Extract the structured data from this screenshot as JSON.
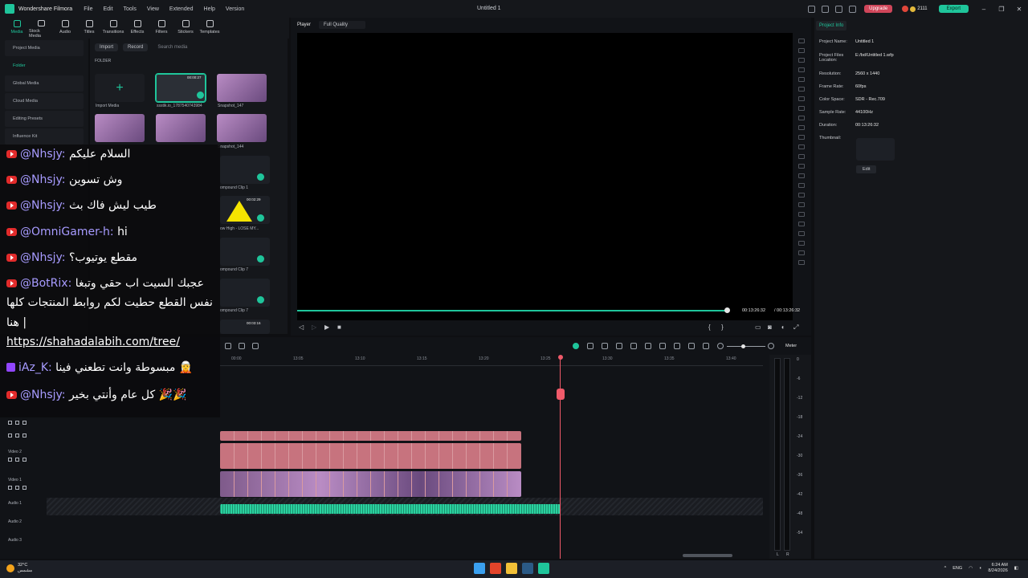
{
  "app": {
    "name": "Wondershare Filmora",
    "doc_title": "Untitled 1",
    "menus": [
      "File",
      "Edit",
      "Tools",
      "View",
      "Extended",
      "Help",
      "Version"
    ],
    "upgrade": "Upgrade",
    "credits": "2111",
    "export": "Export"
  },
  "tabs": [
    "Media",
    "Stock Media",
    "Audio",
    "Titles",
    "Transitions",
    "Effects",
    "Filters",
    "Stickers",
    "Templates"
  ],
  "sidebar": {
    "items": [
      "Project Media",
      "Folder",
      "Global Media",
      "Cloud Media",
      "Editing Presets",
      "Influence Kit"
    ]
  },
  "media": {
    "import": "Import",
    "record": "Record",
    "search_placeholder": "Search media",
    "folder_label": "FOLDER",
    "items": [
      {
        "label": "Import Media"
      },
      {
        "label": "ssstik.io_1787540743984",
        "duration": "00:00:27"
      },
      {
        "label": "Snapshot_147"
      },
      {
        "label": ""
      },
      {
        "label": ""
      },
      {
        "label": "Snapshot_144"
      },
      {
        "label": "ompound Clip 1"
      },
      {
        "label": "ow High - LOSE MY...",
        "duration": "00:02:29"
      },
      {
        "label": "ompound Clip 7"
      },
      {
        "label": "ompound Clip 7"
      },
      {
        "label": "",
        "duration": "00:03:16"
      }
    ]
  },
  "player": {
    "label": "Player",
    "quality": "Full Quality",
    "current": "00:13:26:32",
    "total": "/  00:13:26:32",
    "progress": 0.99
  },
  "project_info": {
    "tab": "Project Info",
    "rows": [
      {
        "k": "Project Name:",
        "v": "Untitled 1"
      },
      {
        "k": "Project Files Location:",
        "v": "E:/bd/Untitled 1.wfp"
      },
      {
        "k": "Resolution:",
        "v": "2560 x 1440"
      },
      {
        "k": "Frame Rate:",
        "v": "60fps"
      },
      {
        "k": "Color Space:",
        "v": "SDR - Rec.709"
      },
      {
        "k": "Sample Rate:",
        "v": "44100Hz"
      },
      {
        "k": "Duration:",
        "v": "00:13:26:32"
      },
      {
        "k": "Thumbnail:",
        "v": ""
      }
    ],
    "edit": "Edit"
  },
  "timeline": {
    "meter": "Meter",
    "ruler": [
      "00:00",
      "13:05",
      "13:10",
      "13:15",
      "13:20",
      "13:25",
      "13:30",
      "13:35",
      "13:40"
    ],
    "tracks": [
      "Video 2",
      "Video 1",
      "Audio 1",
      "Audio 2",
      "Audio 3"
    ],
    "db": [
      "0",
      "-6",
      "-12",
      "-18",
      "-24",
      "-30",
      "-36",
      "-42",
      "-48",
      "-54"
    ],
    "lr": [
      "L",
      "R"
    ]
  },
  "chat": [
    {
      "platform": "youtube",
      "name": "@Nhsjy",
      "text": "السلام عليكم"
    },
    {
      "platform": "youtube",
      "name": "@Nhsjy",
      "text": "وش تسوين"
    },
    {
      "platform": "youtube",
      "name": "@Nhsjy",
      "text": "طيب ليش فاك بث"
    },
    {
      "platform": "youtube",
      "name": "@OmniGamer-h",
      "text": "hi"
    },
    {
      "platform": "youtube",
      "name": "@Nhsjy",
      "text": "مقطع يوتيوب؟"
    },
    {
      "platform": "youtube",
      "name": "@BotRix",
      "text": "عجبك السيت اب حقي وتبغا"
    },
    {
      "line": "نفس القطع حطيت لكم روابط المنتجات كلها"
    },
    {
      "line": "هنا |"
    },
    {
      "line": "https://shahadalabih.com/tree/"
    },
    {
      "platform": "twitch",
      "name": "iAz_K",
      "text": "مبسوطة وانت تطعني فينا 🧝"
    },
    {
      "platform": "youtube",
      "name": "@Nhsjy",
      "text": "كل عام وأنتي بخير 🎉🎉"
    }
  ],
  "taskbar": {
    "temp": "32°C",
    "condition": "مشمس",
    "lang": "ENG",
    "time": "6:24 AM",
    "date": "8/24/2026"
  },
  "colors": {
    "accent": "#1fc59b",
    "clip": "#c7737e",
    "playhead": "#f05a6a",
    "upgrade": "#d0465a"
  }
}
